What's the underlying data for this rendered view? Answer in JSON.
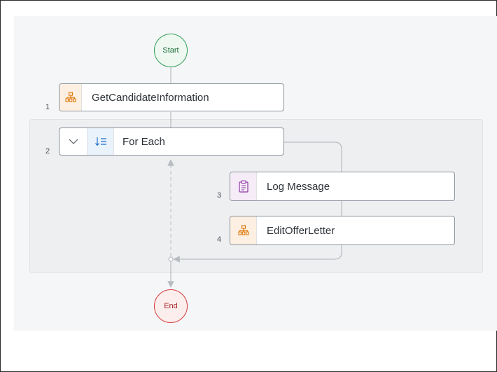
{
  "diagram": {
    "start_label": "Start",
    "end_label": "End",
    "steps": [
      {
        "number": "1",
        "label": "GetCandidateInformation",
        "icon": "org-chart-icon"
      },
      {
        "number": "2",
        "label": "For Each",
        "icon": "sort-list-icon"
      },
      {
        "number": "3",
        "label": "Log Message",
        "icon": "clipboard-icon"
      },
      {
        "number": "4",
        "label": "EditOfferLetter",
        "icon": "org-chart-icon"
      }
    ]
  },
  "colors": {
    "start_border": "#2e9e58",
    "end_border": "#d23b3b",
    "action_icon": "#e07a10",
    "log_icon": "#8e3aa5",
    "loop_icon": "#1f6fc5",
    "connector": "#b8bcc2"
  }
}
